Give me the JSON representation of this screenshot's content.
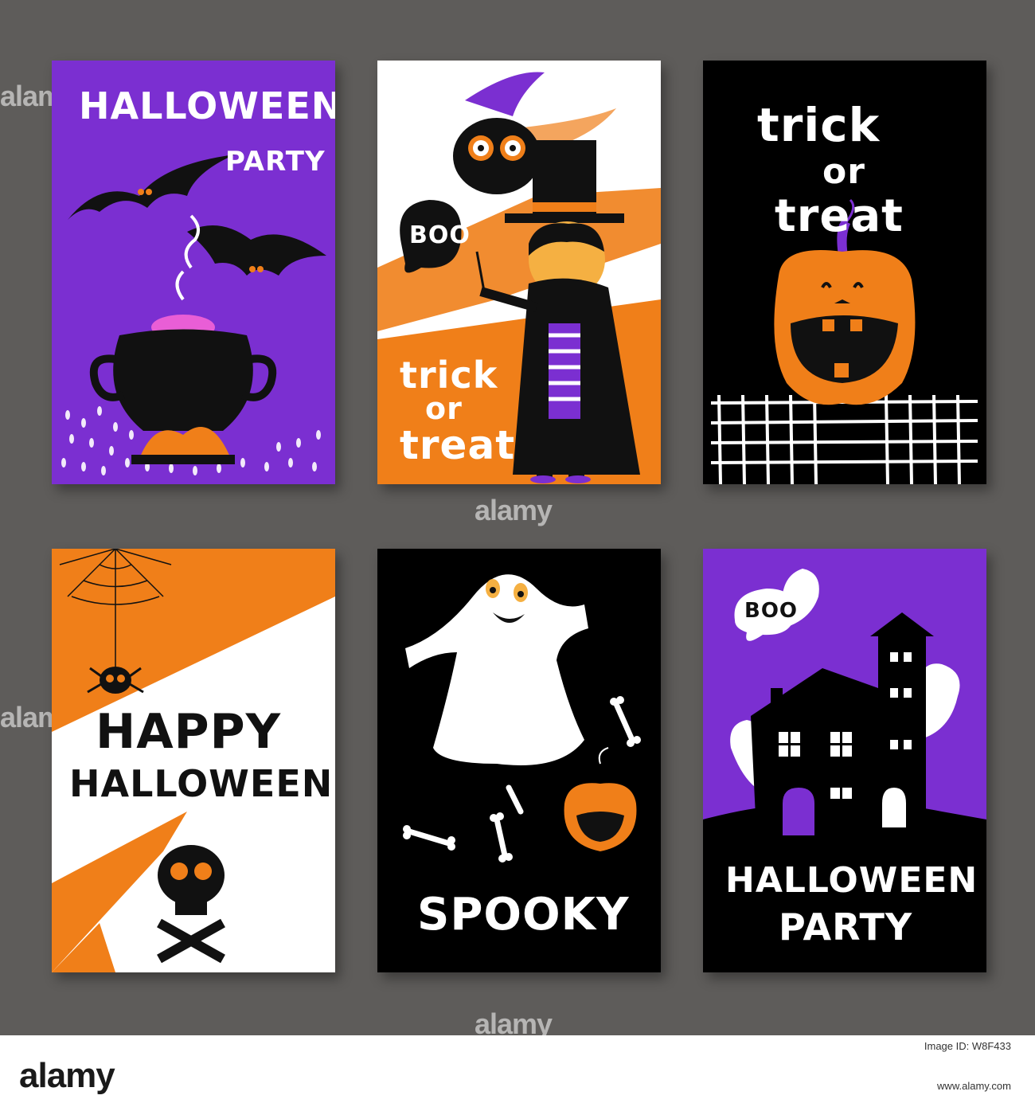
{
  "colors": {
    "background": "#5e5c5a",
    "purple": "#7b2fd1",
    "orange": "#f07f19",
    "black": "#000000",
    "white": "#ffffff"
  },
  "cards": [
    {
      "title_line1": "HALLOWEEN",
      "title_line2": "PARTY",
      "theme": "bats-and-cauldron"
    },
    {
      "speech": "BOO",
      "title_line1": "trick",
      "title_line2": "or",
      "title_line3": "treat",
      "theme": "owl-and-magician"
    },
    {
      "title_line1": "trick",
      "title_line2": "or",
      "title_line3": "treat",
      "theme": "jack-o-lantern"
    },
    {
      "title_line1": "HAPPY",
      "title_line2": "HALLOWEEN",
      "theme": "spider-and-skull"
    },
    {
      "title_line1": "SPOOKY",
      "theme": "ghost-and-bones"
    },
    {
      "speech": "BOO",
      "title_line1": "HALLOWEEN",
      "title_line2": "PARTY",
      "theme": "haunted-house"
    }
  ],
  "watermark": "alamy",
  "footer": {
    "logo": "alamy",
    "image_id": "Image ID: W8F433",
    "url": "www.alamy.com"
  }
}
